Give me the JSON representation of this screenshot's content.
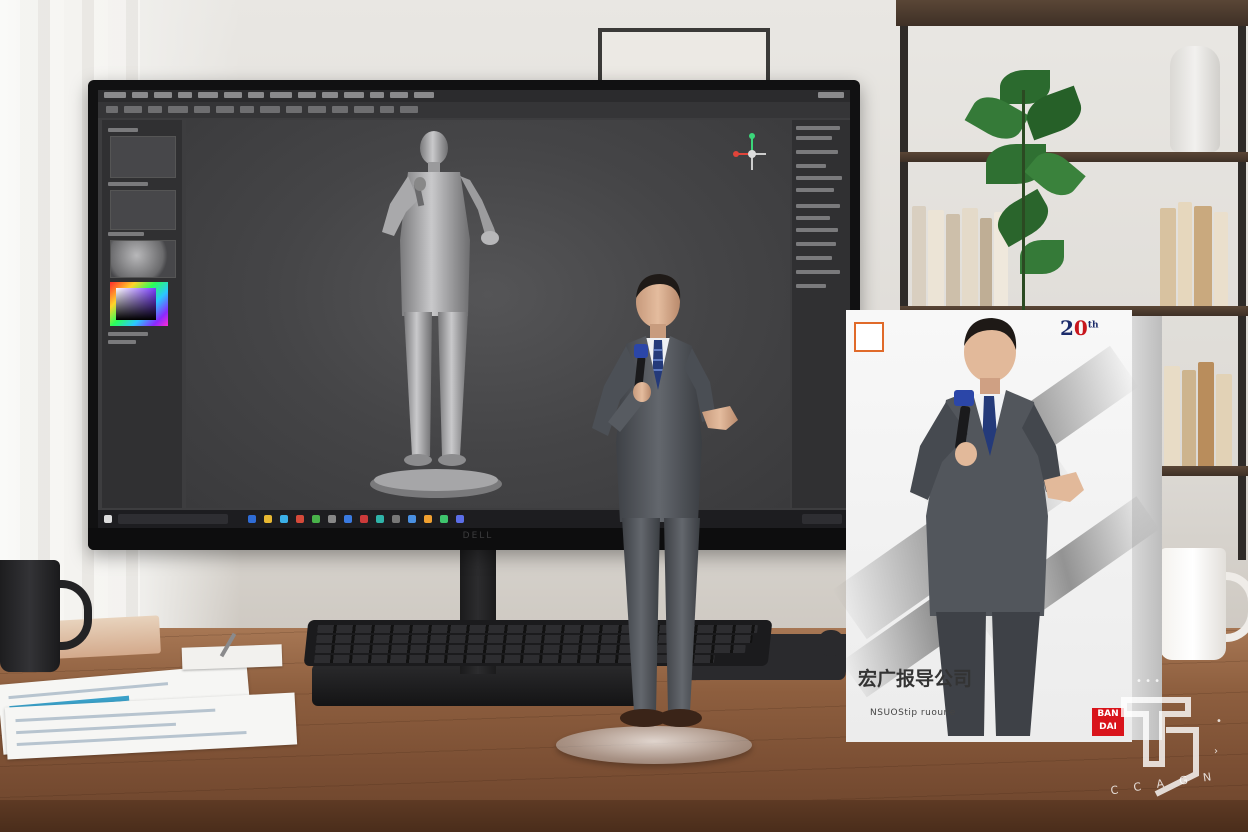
{
  "scene": {
    "monitor_brand": "DELL",
    "app_window": {
      "panel_headers": [],
      "viewport_model": "3D sculpt of man in suit holding microphone on round base"
    },
    "desk_items": {
      "figure": "Painted figure of man in grey suit holding microphone on clear acrylic base"
    },
    "product_box": {
      "year_badge_prefix": "2",
      "year_badge_suffix": "0",
      "year_badge_mark": "th",
      "title": "宏广报导公司",
      "subtitle": "NSUOStip ruoune",
      "brand_logo_line1": "BAN",
      "brand_logo_line2": "DAI"
    },
    "watermark": {
      "text": "C C A G N"
    }
  },
  "colors": {
    "suit": "#5a5d62",
    "suit_dark": "#3b3e43",
    "tie": "#243a7a",
    "desk": "#8e5f3f",
    "screen_bg": "#3d3d3f",
    "brand_red": "#d9141b",
    "brand_navy": "#1c2c6b"
  },
  "icons": [
    "windows-start-icon",
    "search-icon",
    "gizmo-axis-icon",
    "color-picker-icon"
  ]
}
